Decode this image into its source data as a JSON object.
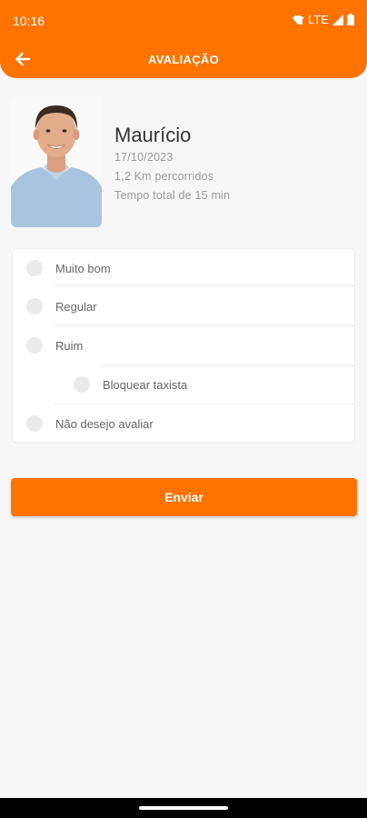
{
  "status_bar": {
    "time": "10:16",
    "network": "LTE",
    "icons": [
      "wifi-icon",
      "signal-icon",
      "battery-icon"
    ]
  },
  "app_bar": {
    "title": "AVALIAÇÃO",
    "back_icon": "arrow-left-icon"
  },
  "driver": {
    "name": "Maurício",
    "date": "17/10/2023",
    "distance": "1,2 Km percorridos",
    "total_time": "Tempo total de 15 min"
  },
  "rating_options": [
    {
      "label": "Muito bom",
      "selected": false
    },
    {
      "label": "Regular",
      "selected": false
    },
    {
      "label": "Ruim",
      "selected": false
    },
    {
      "label": "Bloquear taxista",
      "selected": false
    },
    {
      "label": "Não desejo avaliar",
      "selected": false
    }
  ],
  "submit_label": "Enviar",
  "colors": {
    "primary": "#ff7300",
    "background": "#f7f7f7",
    "text_dark": "#333333",
    "text_muted": "#9a9a9a"
  }
}
